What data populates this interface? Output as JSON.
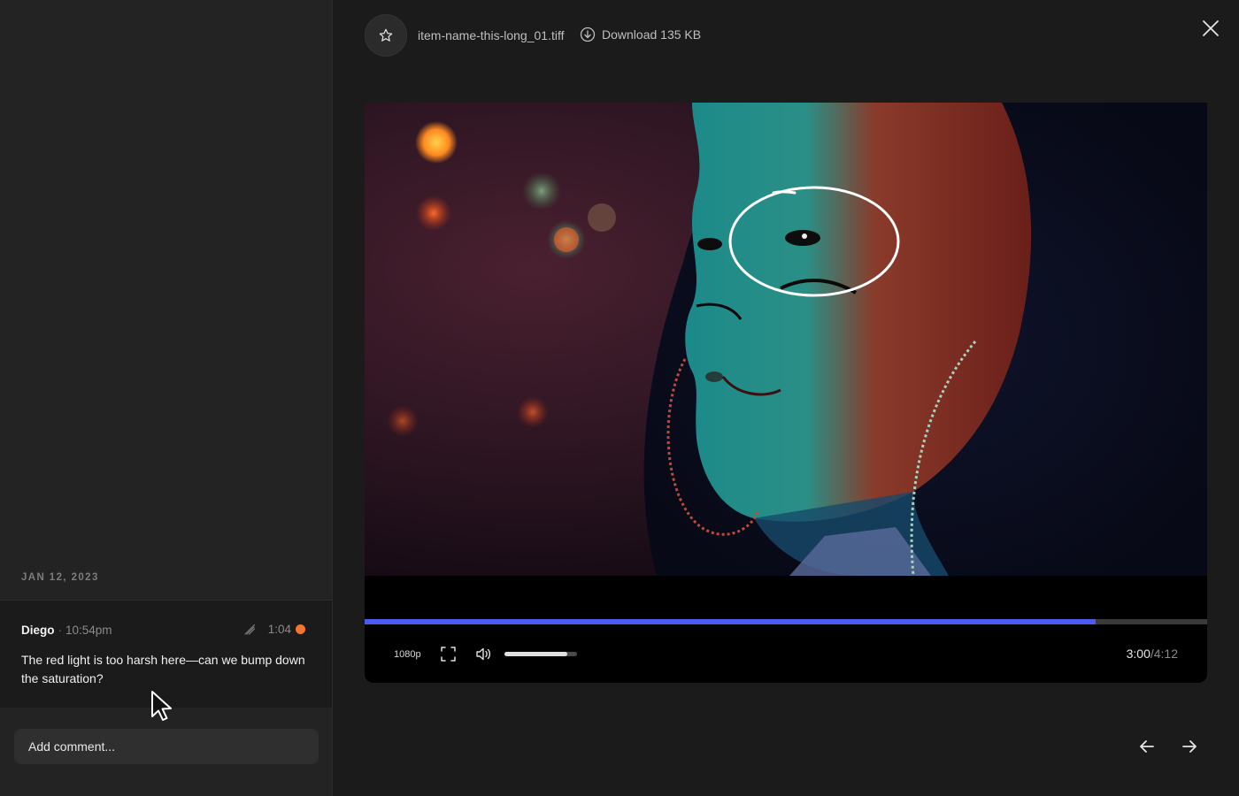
{
  "sidebar": {
    "date_label": "JAN 12, 2023",
    "comment": {
      "author": "Diego",
      "separator": "·",
      "time": "10:54pm",
      "timestamp": "1:04",
      "status_color": "#f2762c",
      "text": "The red light is too harsh here—can we bump down the saturation?"
    },
    "input_placeholder": "Add comment..."
  },
  "header": {
    "file_name": "item-name-this-long_01.tiff",
    "download_label": "Download 135 KB",
    "icons": [
      "star-icon",
      "download-icon",
      "close-icon"
    ]
  },
  "player": {
    "quality": "1080p",
    "progress": 0.868,
    "volume": 0.87,
    "current_time": "3:00",
    "total_time": "/4:12",
    "accent_color": "#4b5cf2"
  },
  "navigation": {
    "icons": [
      "arrow-left-icon",
      "arrow-right-icon"
    ]
  }
}
